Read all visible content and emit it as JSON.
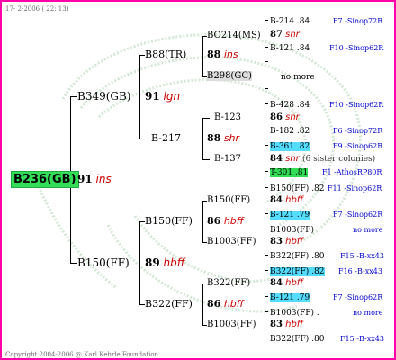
{
  "header": {
    "date_text": "17- 2-2006 ( 22: 13)"
  },
  "footer": {
    "copyright": "Copyright 2004-2006 @ Karl Kehrle Foundation."
  },
  "root": {
    "label": "B236(GB)",
    "num": "91",
    "note": "ins"
  },
  "gen1": [
    {
      "label": "B349(GB)",
      "num": "91",
      "note": "lgn"
    },
    {
      "label": "B150(FF)",
      "num": "89",
      "note": "hbff"
    }
  ],
  "gen2": [
    {
      "label": "B88(TR)",
      "num": "88",
      "note": "ins"
    },
    {
      "label": "B-217",
      "num": "88",
      "note": "shr"
    },
    {
      "label": "B150(FF)",
      "num": "86",
      "note": "hbff"
    },
    {
      "label": "B322(FF)",
      "num": "86",
      "note": "hbff"
    }
  ],
  "gen3": [
    {
      "label": "BO214(MS)",
      "num": "87",
      "note": "shr"
    },
    {
      "label": "B298(GC)",
      "more": "no more"
    },
    {
      "label": "B-123",
      "num": "86",
      "note": "shr"
    },
    {
      "label": "B-137",
      "num": "84",
      "note": "shr",
      "extra": "(6 sister colonies)"
    },
    {
      "label": "B150(FF)",
      "num": "84",
      "note": "hbff"
    },
    {
      "label": "B1003(FF)",
      "num": "83",
      "note": "hbff"
    },
    {
      "label": "B322(FF)",
      "num": "84",
      "note": "hbff"
    },
    {
      "label": "B1003(FF)",
      "num": "83",
      "note": "hbff"
    }
  ],
  "gen4": [
    {
      "name": "B-214",
      "score": ".84",
      "source": "F7 -Sinop72R"
    },
    {
      "name": "B-121",
      "score": ".84",
      "source": "F10 -Sinop62R"
    },
    {
      "name": "B-428",
      "score": ".84",
      "source": "F10 -Sinop62R"
    },
    {
      "name": "B-182",
      "score": ".82",
      "source": "F6 -Sinop72R"
    },
    {
      "name": "B-361",
      "score": ".82",
      "source": "F9 -Sinop62R"
    },
    {
      "name": "T-301",
      "score": ".81",
      "source": "F1 -AthosRP80R"
    },
    {
      "name": "B150(FF)",
      "score": ".82",
      "source": "F11 -Sinop62R"
    },
    {
      "name": "B-121",
      "score": ".79",
      "source": "F7 -Sinop62R"
    },
    {
      "name": "B1003(FF)",
      "score": "",
      "source": "no more"
    },
    {
      "name": "B322(FF)",
      "score": ".80",
      "source": "F15 -B-xx43"
    },
    {
      "name": "B322(FF)",
      "score": ".82",
      "source": "F16 -B-xx43"
    },
    {
      "name": "B-121",
      "score": ".79",
      "source": "F7 -Sinop62R"
    },
    {
      "name": "B1003(FF)",
      "score": ".",
      "source": "no more"
    },
    {
      "name": "B322(FF)",
      "score": ".80",
      "source": "F15 -B-xx43"
    }
  ],
  "colors": {
    "frame": "#ff00aa",
    "root_bg": "#33dd55",
    "cyan": "#55ddff",
    "note": "#cc0000",
    "source": "#0000cc"
  }
}
